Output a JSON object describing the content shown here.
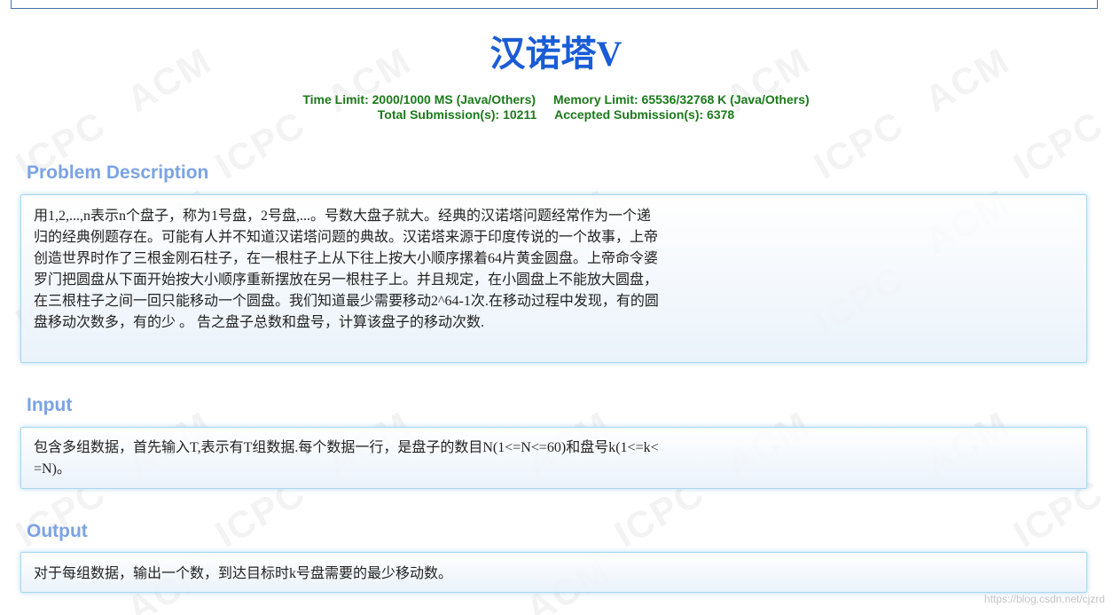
{
  "problem": {
    "title": "汉诺塔V",
    "time_limit": "Time Limit: 2000/1000 MS (Java/Others)",
    "memory_limit": "Memory Limit: 65536/32768 K (Java/Others)",
    "total_submissions": "Total Submission(s): 10211",
    "accepted_submissions": "Accepted Submission(s): 6378"
  },
  "sections": {
    "description": {
      "heading": "Problem Description",
      "body": "用1,2,...,n表示n个盘子，称为1号盘，2号盘,...。号数大盘子就大。经典的汉诺塔问题经常作为一个递归的经典例题存在。可能有人并不知道汉诺塔问题的典故。汉诺塔来源于印度传说的一个故事，上帝创造世界时作了三根金刚石柱子，在一根柱子上从下往上按大小顺序摞着64片黄金圆盘。上帝命令婆罗门把圆盘从下面开始按大小顺序重新摆放在另一根柱子上。并且规定，在小圆盘上不能放大圆盘，在三根柱子之间一回只能移动一个圆盘。我们知道最少需要移动2^64-1次.在移动过程中发现，有的圆盘移动次数多，有的少 。 告之盘子总数和盘号，计算该盘子的移动次数."
    },
    "input": {
      "heading": "Input",
      "body": "包含多组数据，首先输入T,表示有T组数据.每个数据一行，是盘子的数目N(1<=N<=60)和盘号k(1<=k<=N)。"
    },
    "output": {
      "heading": "Output",
      "body": "对于每组数据，输出一个数，到达目标时k号盘需要的最少移动数。"
    }
  },
  "watermark": {
    "acm": "ACM",
    "icpc": "ICPC",
    "credit": "https://blog.csdn.net/cjzrd"
  },
  "colors": {
    "title": "#1a5cd6",
    "limits": "#1b7a1b",
    "section_heading": "#7aa3e5",
    "panel_border": "#a9d8ee"
  }
}
